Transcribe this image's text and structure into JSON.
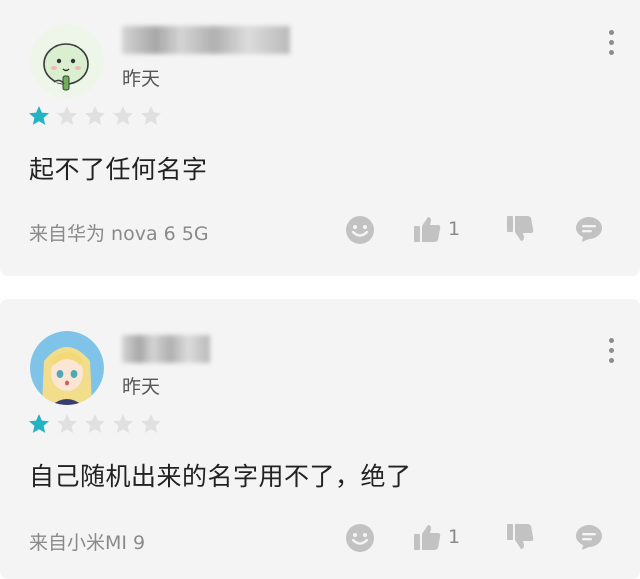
{
  "reviews": [
    {
      "avatar": "cartoon-avatar",
      "time": "昨天",
      "rating": 1,
      "max_rating": 5,
      "comment": "起不了任何名字",
      "device": "来自华为 nova 6 5G",
      "like_count": "1"
    },
    {
      "avatar": "anime-avatar",
      "time": "昨天",
      "rating": 1,
      "max_rating": 5,
      "comment": "自己随机出来的名字用不了，绝了",
      "device": "来自小米MI 9",
      "like_count": "1"
    }
  ],
  "colors": {
    "star_filled": "#22b3c4",
    "star_empty": "#e0e0e0",
    "icon_gray": "#c2c2c2",
    "card_bg": "#f4f4f4"
  },
  "icons": [
    "more-icon",
    "star-icon",
    "smiley-icon",
    "thumbs-up-icon",
    "thumbs-down-icon",
    "comment-icon"
  ]
}
